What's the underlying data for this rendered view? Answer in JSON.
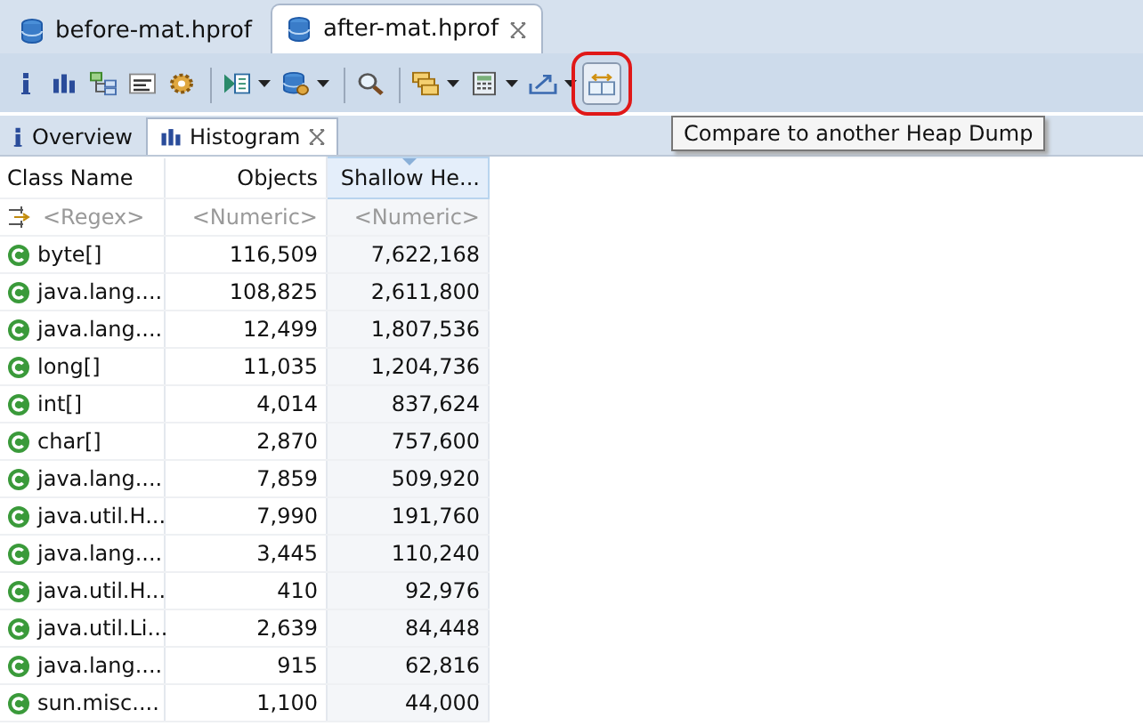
{
  "editor_tabs": [
    {
      "label": "before-mat.hprof",
      "selected": false,
      "closable": false
    },
    {
      "label": "after-mat.hprof",
      "selected": true,
      "closable": true
    }
  ],
  "toolbar": [
    {
      "kind": "info",
      "dropdown": false,
      "separator_before": false,
      "highlighted": false
    },
    {
      "kind": "histogram",
      "dropdown": false,
      "separator_before": false,
      "highlighted": false
    },
    {
      "kind": "tree",
      "dropdown": false,
      "separator_before": false,
      "highlighted": false
    },
    {
      "kind": "oql",
      "dropdown": false,
      "separator_before": false,
      "highlighted": false
    },
    {
      "kind": "gears",
      "dropdown": false,
      "separator_before": false,
      "highlighted": false
    },
    {
      "kind": "report",
      "dropdown": true,
      "separator_before": true,
      "highlighted": false
    },
    {
      "kind": "dbgear",
      "dropdown": true,
      "separator_before": false,
      "highlighted": false
    },
    {
      "kind": "search",
      "dropdown": false,
      "separator_before": true,
      "highlighted": false
    },
    {
      "kind": "windows",
      "dropdown": true,
      "separator_before": true,
      "highlighted": false
    },
    {
      "kind": "calculator",
      "dropdown": true,
      "separator_before": false,
      "highlighted": false
    },
    {
      "kind": "export",
      "dropdown": true,
      "separator_before": false,
      "highlighted": false
    },
    {
      "kind": "compare",
      "dropdown": false,
      "separator_before": false,
      "highlighted": true
    }
  ],
  "tooltip": "Compare to another Heap Dump",
  "view_tabs": [
    {
      "kind": "info",
      "label": "Overview",
      "selected": false,
      "closable": false
    },
    {
      "kind": "histogram",
      "label": "Histogram",
      "selected": true,
      "closable": true
    }
  ],
  "table": {
    "columns": [
      {
        "label": "Class Name",
        "filter": "<Regex>",
        "sorted": false
      },
      {
        "label": "Objects",
        "filter": "<Numeric>",
        "sorted": false
      },
      {
        "label": "Shallow He...",
        "filter": "<Numeric>",
        "sorted": true
      }
    ],
    "rows": [
      [
        "byte[]",
        "116,509",
        "7,622,168"
      ],
      [
        "java.lang....",
        "108,825",
        "2,611,800"
      ],
      [
        "java.lang....",
        "12,499",
        "1,807,536"
      ],
      [
        "long[]",
        "11,035",
        "1,204,736"
      ],
      [
        "int[]",
        "4,014",
        "837,624"
      ],
      [
        "char[]",
        "2,870",
        "757,600"
      ],
      [
        "java.lang....",
        "7,859",
        "509,920"
      ],
      [
        "java.util.H...",
        "7,990",
        "191,760"
      ],
      [
        "java.lang....",
        "3,445",
        "110,240"
      ],
      [
        "java.util.H...",
        "410",
        "92,976"
      ],
      [
        "java.util.Li...",
        "2,639",
        "84,448"
      ],
      [
        "java.lang....",
        "915",
        "62,816"
      ],
      [
        "sun.misc....",
        "1,100",
        "44,000"
      ]
    ]
  }
}
